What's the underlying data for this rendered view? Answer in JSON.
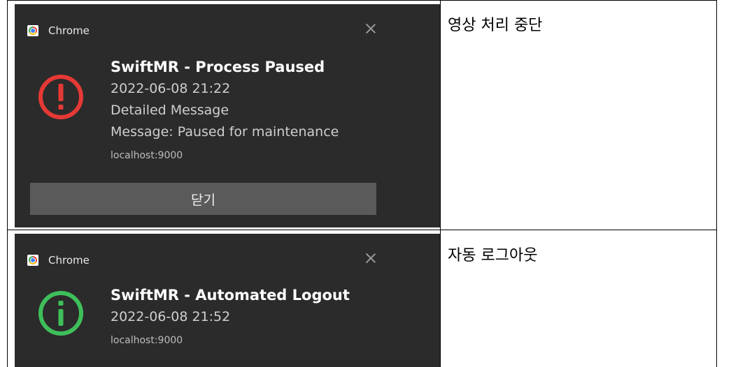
{
  "rows": [
    {
      "notification": {
        "app_name": "Chrome",
        "icon": "error-exclamation-icon",
        "icon_color": "#e53935",
        "title": "SwiftMR - Process Paused",
        "timestamp": "2022-06-08 21:22",
        "detail_line1": "Detailed Message",
        "detail_line2": "Message: Paused for maintenance",
        "source": "localhost:9000",
        "action_label": "닫기"
      },
      "caption": "영상 처리 중단"
    },
    {
      "notification": {
        "app_name": "Chrome",
        "icon": "info-icon",
        "icon_color": "#3fbf5a",
        "title": "SwiftMR - Automated Logout",
        "timestamp": "2022-06-08 21:52",
        "source": "localhost:9000"
      },
      "caption": "자동 로그아웃"
    }
  ],
  "colors": {
    "notification_bg": "#2b2b2b",
    "button_bg": "#5a5a5a"
  }
}
